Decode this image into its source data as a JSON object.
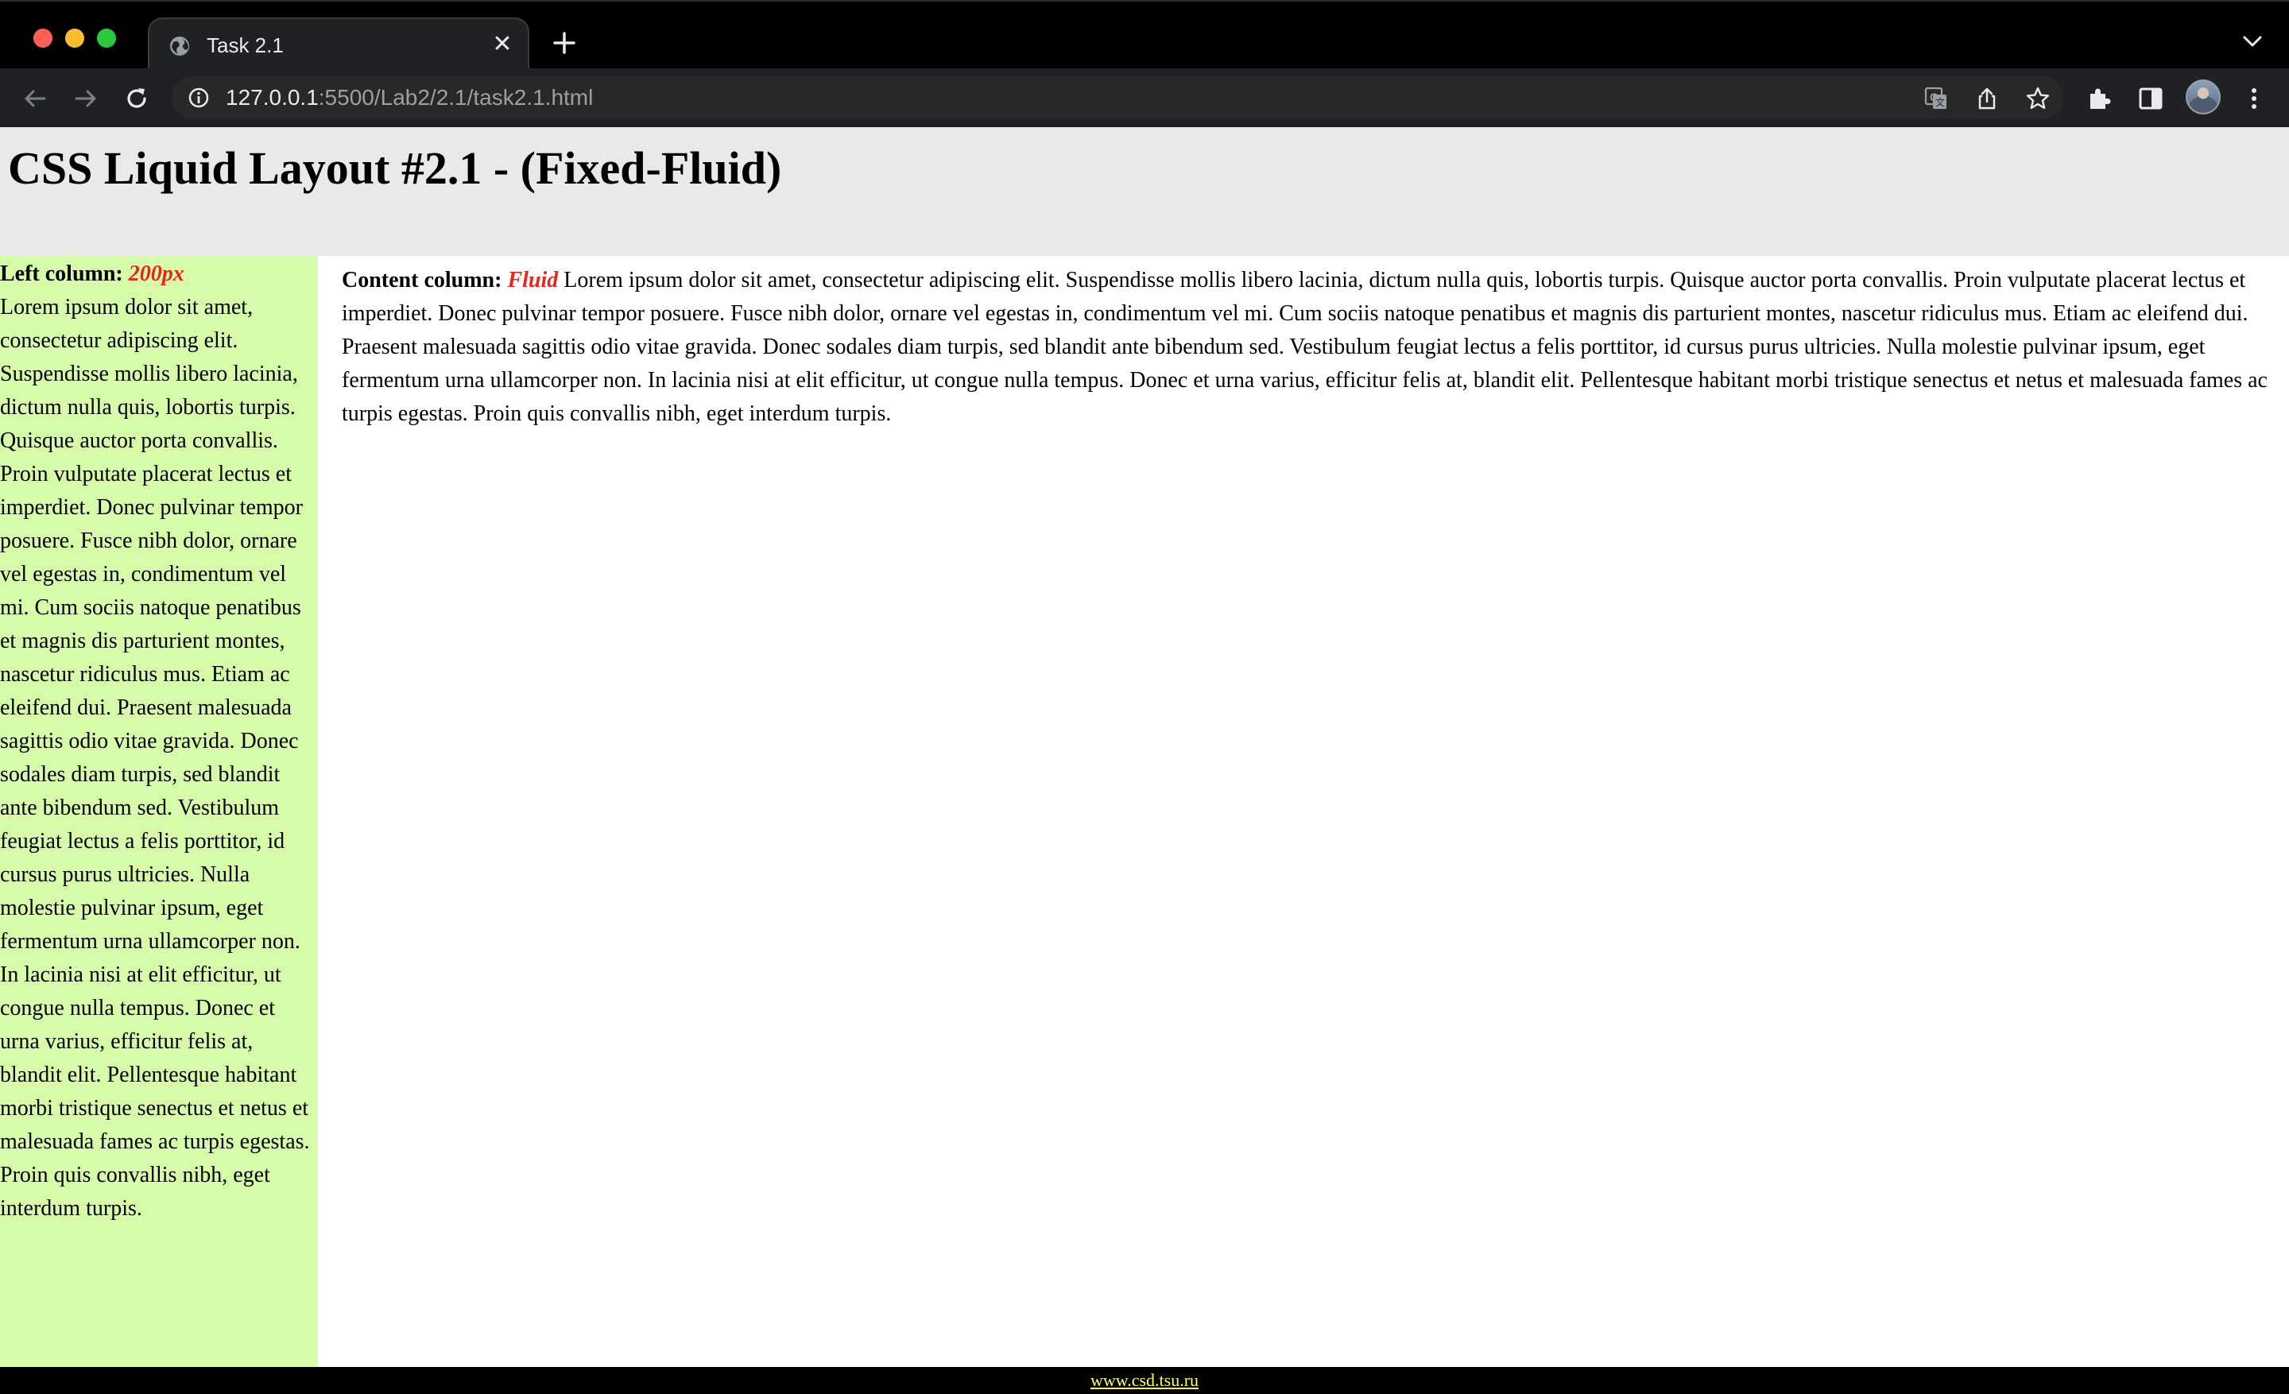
{
  "browser": {
    "tab_title": "Task 2.1",
    "url_host": "127.0.0.1",
    "url_path": ":5500/Lab2/2.1/task2.1.html"
  },
  "page": {
    "heading": "CSS Liquid Layout #2.1 - (Fixed-Fluid)",
    "left_column": {
      "label": "Left column:",
      "accent": "200px",
      "text": "Lorem ipsum dolor sit amet, consectetur adipiscing elit. Suspendisse mollis libero lacinia, dictum nulla quis, lobortis turpis. Quisque auctor porta convallis. Proin vulputate placerat lectus et imperdiet. Donec pulvinar tempor posuere. Fusce nibh dolor, ornare vel egestas in, condimentum vel mi. Cum sociis natoque penatibus et magnis dis parturient montes, nascetur ridiculus mus. Etiam ac eleifend dui. Praesent malesuada sagittis odio vitae gravida. Donec sodales diam turpis, sed blandit ante bibendum sed. Vestibulum feugiat lectus a felis porttitor, id cursus purus ultricies. Nulla molestie pulvinar ipsum, eget fermentum urna ullamcorper non. In lacinia nisi at elit efficitur, ut congue nulla tempus. Donec et urna varius, efficitur felis at, blandit elit. Pellentesque habitant morbi tristique senectus et netus et malesuada fames ac turpis egestas. Proin quis convallis nibh, eget interdum turpis."
    },
    "content_column": {
      "label": "Content column:",
      "accent": "Fluid",
      "text": "Lorem ipsum dolor sit amet, consectetur adipiscing elit. Suspendisse mollis libero lacinia, dictum nulla quis, lobortis turpis. Quisque auctor porta convallis. Proin vulputate placerat lectus et imperdiet. Donec pulvinar tempor posuere. Fusce nibh dolor, ornare vel egestas in, condimentum vel mi. Cum sociis natoque penatibus et magnis dis parturient montes, nascetur ridiculus mus. Etiam ac eleifend dui. Praesent malesuada sagittis odio vitae gravida. Donec sodales diam turpis, sed blandit ante bibendum sed. Vestibulum feugiat lectus a felis porttitor, id cursus purus ultricies. Nulla molestie pulvinar ipsum, eget fermentum urna ullamcorper non. In lacinia nisi at elit efficitur, ut congue nulla tempus. Donec et urna varius, efficitur felis at, blandit elit. Pellentesque habitant morbi tristique senectus et netus et malesuada fames ac turpis egestas. Proin quis convallis nibh, eget interdum turpis."
    },
    "footer_link": "www.csd.tsu.ru"
  },
  "colors": {
    "header_bg": "#e9e9e9",
    "left_column_bg": "#d6fca9",
    "accent": "#e8261c",
    "footer_bg": "#000000",
    "footer_link": "#ffff66"
  },
  "icons": {
    "tab_favicon": "globe-icon",
    "back": "arrow-left-icon",
    "forward": "arrow-right-icon",
    "reload": "reload-icon",
    "site_info": "info-icon",
    "translate": "translate-icon",
    "share": "share-icon",
    "bookmark": "star-icon",
    "extensions": "puzzle-icon",
    "side_panel": "side-panel-icon",
    "menu": "kebab-menu-icon"
  }
}
